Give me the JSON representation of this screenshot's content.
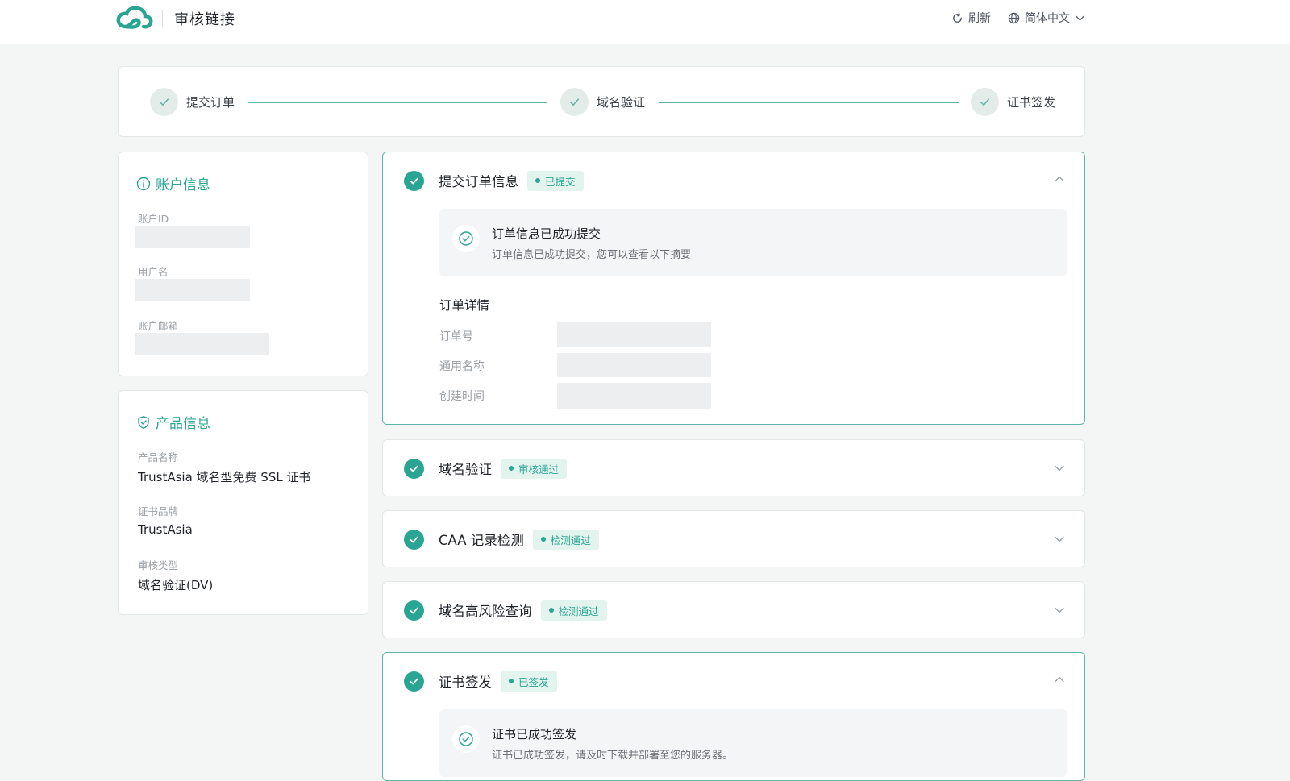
{
  "header": {
    "app_title": "审核链接",
    "refresh_label": "刷新",
    "language_label": "简体中文"
  },
  "steps": [
    {
      "label": "提交订单",
      "status": "done"
    },
    {
      "label": "域名验证",
      "status": "done"
    },
    {
      "label": "证书签发",
      "status": "done"
    }
  ],
  "account": {
    "title": "账户信息",
    "fields": [
      {
        "label": "账户ID",
        "value": ""
      },
      {
        "label": "用户名",
        "value": ""
      },
      {
        "label": "账户邮箱",
        "value": ""
      }
    ]
  },
  "product": {
    "title": "产品信息",
    "fields": [
      {
        "label": "产品名称",
        "value": "TrustAsia 域名型免费 SSL 证书"
      },
      {
        "label": "证书品牌",
        "value": "TrustAsia"
      },
      {
        "label": "审核类型",
        "value": "域名验证(DV)"
      }
    ]
  },
  "sections": [
    {
      "title": "提交订单信息",
      "badge": "已提交",
      "expanded": true,
      "notice_title": "订单信息已成功提交",
      "notice_desc": "订单信息已成功提交，您可以查看以下摘要",
      "details_heading": "订单详情",
      "details": [
        {
          "label": "订单号",
          "value": ""
        },
        {
          "label": "通用名称",
          "value": ""
        },
        {
          "label": "创建时间",
          "value": ""
        }
      ]
    },
    {
      "title": "域名验证",
      "badge": "审核通过",
      "expanded": false
    },
    {
      "title": "CAA 记录检测",
      "badge": "检测通过",
      "expanded": false
    },
    {
      "title": "域名高风险查询",
      "badge": "检测通过",
      "expanded": false
    },
    {
      "title": "证书签发",
      "badge": "已签发",
      "expanded": true,
      "notice_title": "证书已成功签发",
      "notice_desc": "证书已成功签发，请及时下载并部署至您的服务器。"
    }
  ],
  "colors": {
    "accent": "#2aa593",
    "accent_light": "#e3f4ef",
    "step_line": "#5fb5a5",
    "page_bg": "#f4f6f6"
  },
  "icons": {
    "logo": "cloud-logo-icon",
    "refresh": "refresh-icon",
    "language": "globe-icon",
    "check": "check-icon",
    "info": "info-icon",
    "shield": "shield-check-icon",
    "expand": "chevron-down-icon",
    "collapse": "chevron-up-icon"
  }
}
